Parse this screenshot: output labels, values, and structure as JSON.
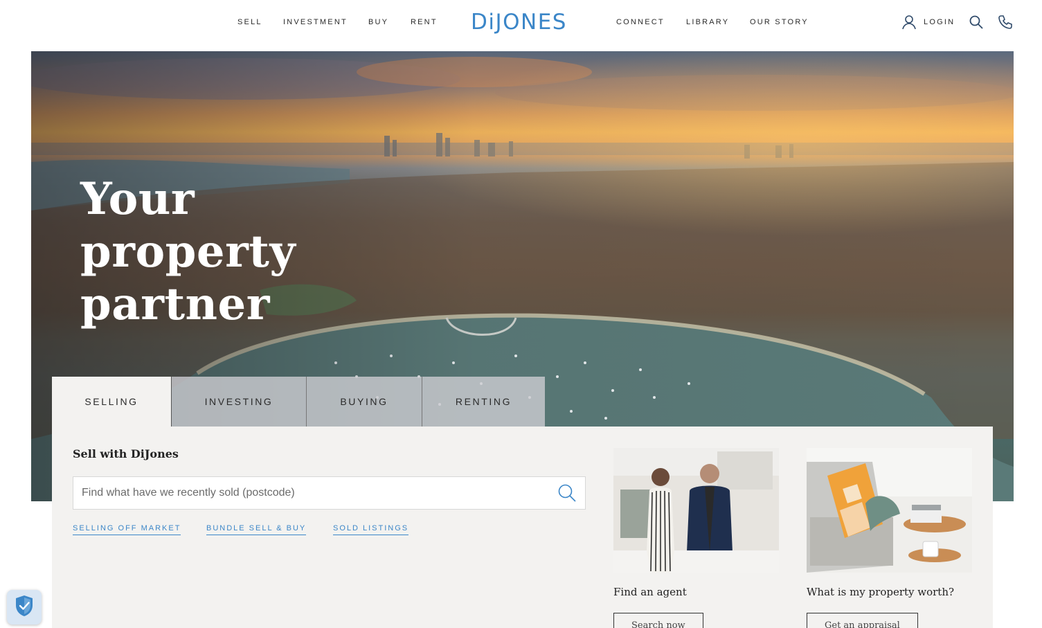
{
  "header": {
    "left_nav": [
      {
        "label": "SELL"
      },
      {
        "label": "INVESTMENT"
      },
      {
        "label": "BUY"
      },
      {
        "label": "RENT"
      }
    ],
    "logo_text": "DiJONES",
    "right_nav": [
      {
        "label": "CONNECT"
      },
      {
        "label": "LIBRARY"
      },
      {
        "label": "OUR STORY"
      }
    ],
    "login_label": "LOGIN",
    "icons": [
      "user-icon",
      "search-icon",
      "phone-icon"
    ]
  },
  "hero": {
    "title_lines": [
      "Your",
      "property",
      "partner"
    ]
  },
  "panel": {
    "tabs": [
      {
        "label": "SELLING",
        "active": true
      },
      {
        "label": "INVESTING",
        "active": false
      },
      {
        "label": "BUYING",
        "active": false
      },
      {
        "label": "RENTING",
        "active": false
      }
    ],
    "heading": "Sell with DiJones",
    "search_placeholder": "Find what have we recently sold (postcode)",
    "quick_links": [
      {
        "label": "SELLING OFF MARKET"
      },
      {
        "label": "BUNDLE SELL & BUY"
      },
      {
        "label": "SOLD LISTINGS"
      }
    ],
    "cards": [
      {
        "caption": "Find an agent",
        "cta": "Search now",
        "image": "two-agents-photo"
      },
      {
        "caption": "What is my property worth?",
        "cta": "Get an appraisal",
        "image": "living-room-chair-photo"
      }
    ]
  },
  "colors": {
    "brand_blue": "#3b86c8",
    "panel_bg": "#f3f2f0",
    "inactive_tab": "#cdcdd2"
  },
  "privacy_badge": {
    "icon": "shield-check-icon"
  }
}
